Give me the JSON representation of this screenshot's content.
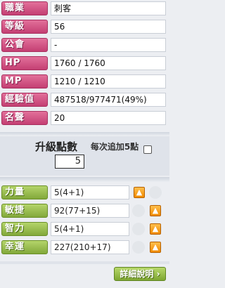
{
  "info": [
    {
      "label": "職業",
      "value": "刺客"
    },
    {
      "label": "等級",
      "value": "56"
    },
    {
      "label": "公會",
      "value": "-"
    },
    {
      "label": "HP",
      "value": "1760 / 1760"
    },
    {
      "label": "MP",
      "value": "1210 / 1210"
    },
    {
      "label": "經驗值",
      "value": "487518/977471(49%)"
    },
    {
      "label": "名聲",
      "value": "20"
    }
  ],
  "ap": {
    "title": "升級點數",
    "value": "5",
    "auto_label": "每次追加5點",
    "auto_checked": false
  },
  "stats": [
    {
      "label": "力量",
      "value": "5(4+1)"
    },
    {
      "label": "敏捷",
      "value": "92(77+15)"
    },
    {
      "label": "智力",
      "value": "5(4+1)"
    },
    {
      "label": "幸運",
      "value": "227(210+17)"
    }
  ],
  "up_icon": "plus-arrow-icon",
  "detail_button": "詳細說明",
  "colors": {
    "info_label": "#d0578a",
    "stat_label": "#9cc04e",
    "up_button": "#f5a020",
    "panel_bg": "#eceef2"
  }
}
